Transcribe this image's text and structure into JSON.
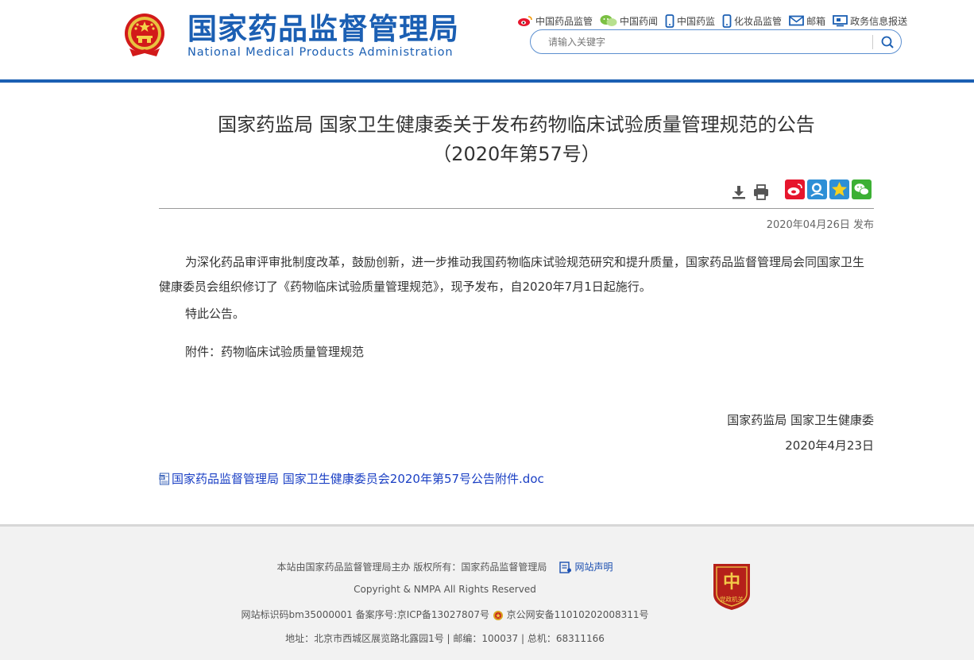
{
  "header": {
    "logo_cn": "国家药品监督管理局",
    "logo_en": "National Medical Products Administration",
    "nav": [
      {
        "label": "中国药品监管",
        "icon": "weibo-icon"
      },
      {
        "label": "中国药闻",
        "icon": "wechat-icon"
      },
      {
        "label": "中国药监",
        "icon": "mobile-icon"
      },
      {
        "label": "化妆品监管",
        "icon": "mobile-app-icon"
      },
      {
        "label": "邮箱",
        "icon": "mail-icon"
      },
      {
        "label": "政务信息报送",
        "icon": "monitor-icon"
      }
    ],
    "search": {
      "placeholder": "请输入关键字"
    }
  },
  "article": {
    "title_line1": "国家药监局 国家卫生健康委关于发布药物临床试验质量管理规范的公告",
    "title_line2": "（2020年第57号）",
    "publish_date": "2020年04月26日 发布",
    "paragraph1": "为深化药品审评审批制度改革，鼓励创新，进一步推动我国药物临床试验规范研究和提升质量，国家药品监督管理局会同国家卫生健康委员会组织修订了《药物临床试验质量管理规范》，现予发布，自2020年7月1日起施行。",
    "paragraph2": "特此公告。",
    "attachment_note": "附件：药物临床试验质量管理规范",
    "signature": "国家药监局 国家卫生健康委",
    "signature_date": "2020年4月23日",
    "attachment_link": "国家药品监督管理局 国家卫生健康委员会2020年第57号公告附件.doc"
  },
  "tools": [
    "download-icon",
    "print-icon"
  ],
  "share": [
    {
      "icon": "weibo-share-icon",
      "color": "#e6162d"
    },
    {
      "icon": "qzone-share-icon",
      "color": "#2d8fd6"
    },
    {
      "icon": "favorite-share-icon",
      "color": "#2d8fd6"
    },
    {
      "icon": "wechat-share-icon",
      "color": "#3cb034"
    }
  ],
  "footer": {
    "host": "本站由国家药品监督管理局主办  版权所有：国家药品监督管理局",
    "statement": "网站声明",
    "copyright": "Copyright & NMPA All Rights Reserved",
    "site_id": "网站标识码bm35000001 备案序号:京ICP备13027807号",
    "police": "京公网安备11010202008311号",
    "address": "地址：北京市西城区展览路北露园1号 | 邮编：100037 | 总机：68311166",
    "badge_label": "党政机关"
  },
  "colors": {
    "brand": "#1b5fb3",
    "link": "#1a3fc4",
    "footer_bg": "#f2f2f2"
  }
}
